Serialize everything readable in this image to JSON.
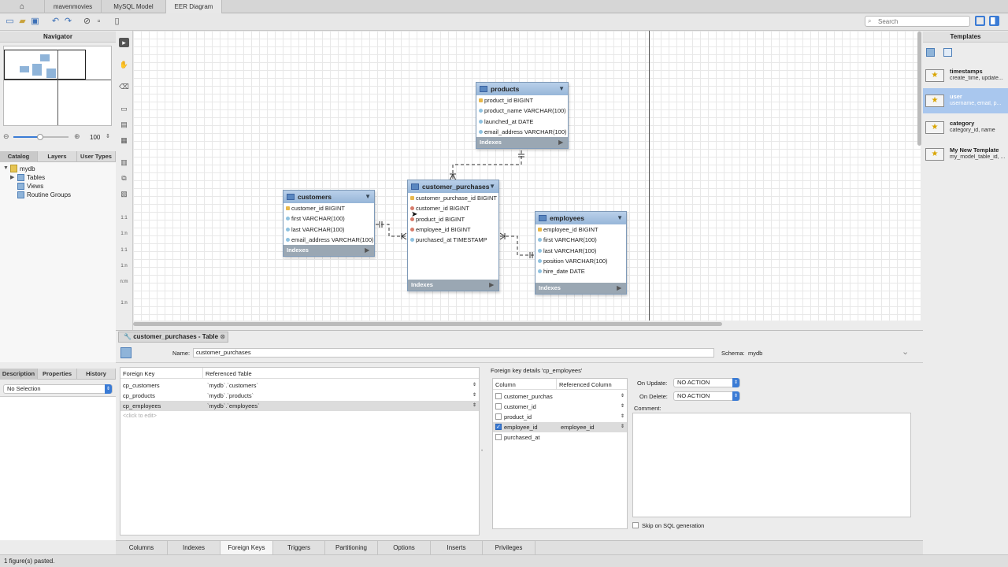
{
  "tabs": [
    {
      "label": "",
      "icon": "home-icon"
    },
    {
      "label": "mavenmovies"
    },
    {
      "label": "MySQL Model"
    },
    {
      "label": "EER Diagram"
    }
  ],
  "search": {
    "placeholder": "Search"
  },
  "navigator": {
    "title": "Navigator",
    "zoom": "100"
  },
  "catalog": {
    "tabs": [
      "Catalog",
      "Layers",
      "User Types"
    ],
    "schema": "mydb",
    "items": [
      "Tables",
      "Views",
      "Routine Groups"
    ]
  },
  "desc": {
    "tabs": [
      "Description",
      "Properties",
      "History"
    ],
    "selection": "No Selection"
  },
  "diagram": {
    "tables": {
      "products": {
        "name": "products",
        "columns": [
          "product_id BIGINT",
          "product_name VARCHAR(100)",
          "launched_at DATE",
          "email_address VARCHAR(100)"
        ]
      },
      "customers": {
        "name": "customers",
        "columns": [
          "customer_id BIGINT",
          "first VARCHAR(100)",
          "last VARCHAR(100)",
          "email_address VARCHAR(100)"
        ]
      },
      "customer_purchases": {
        "name": "customer_purchases",
        "columns": [
          "customer_purchase_id BIGINT",
          "customer_id BIGINT",
          "product_id BIGINT",
          "employee_id BIGINT",
          "purchased_at TIMESTAMP"
        ]
      },
      "employees": {
        "name": "employees",
        "columns": [
          "employee_id BIGINT",
          "first VARCHAR(100)",
          "last VARCHAR(100)",
          "position VARCHAR(100)",
          "hire_date DATE"
        ]
      }
    },
    "indexes_label": "Indexes",
    "relation_labels": [
      "1:1",
      "1:n",
      "1:1",
      "1:n",
      "n:m",
      "1:n"
    ]
  },
  "templates": {
    "title": "Templates",
    "items": [
      {
        "name": "timestamps",
        "desc": "create_time, update..."
      },
      {
        "name": "user",
        "desc": "username, email, p..."
      },
      {
        "name": "category",
        "desc": "category_id, name"
      },
      {
        "name": "My New Template",
        "desc": "my_model_table_id, ..."
      }
    ]
  },
  "editor": {
    "tab_title": "customer_purchases - Table",
    "name_label": "Name:",
    "name_value": "customer_purchases",
    "schema_label": "Schema:",
    "schema_value": "mydb",
    "fk_headers": [
      "Foreign Key",
      "Referenced Table"
    ],
    "fks": [
      {
        "key": "cp_customers",
        "ref": "`mydb`.`customers`"
      },
      {
        "key": "cp_products",
        "ref": "`mydb`.`products`"
      },
      {
        "key": "cp_employees",
        "ref": "`mydb`.`employees`"
      }
    ],
    "fk_placeholder": "<click to edit>",
    "details_title": "Foreign key details 'cp_employees'",
    "col_headers": [
      "Column",
      "Referenced Column"
    ],
    "columns": [
      {
        "name": "customer_purchas",
        "ref": "",
        "checked": false
      },
      {
        "name": "customer_id",
        "ref": "",
        "checked": false
      },
      {
        "name": "product_id",
        "ref": "",
        "checked": false
      },
      {
        "name": "employee_id",
        "ref": "employee_id",
        "checked": true
      },
      {
        "name": "purchased_at",
        "ref": "",
        "checked": false
      }
    ],
    "on_update_label": "On Update:",
    "on_update": "NO ACTION",
    "on_delete_label": "On Delete:",
    "on_delete": "NO ACTION",
    "comment_label": "Comment:",
    "skip_label": "Skip on SQL generation"
  },
  "bottom_tabs": [
    "Columns",
    "Indexes",
    "Foreign Keys",
    "Triggers",
    "Partitioning",
    "Options",
    "Inserts",
    "Privileges"
  ],
  "status": "1 figure(s) pasted."
}
